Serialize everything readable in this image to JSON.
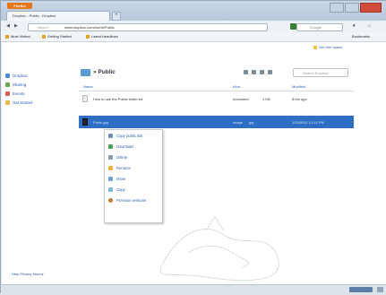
{
  "browser": {
    "app_button": "Firefox",
    "tab_title": "Dropbox - Public - Dropbox",
    "new_tab": "+",
    "url_prefix": "https://",
    "url_domain": "www.dropbox.com/home/Public",
    "search_placeholder": "Google",
    "bookmarks": [
      "Most Visited",
      "Getting Started",
      "Latest Headlines"
    ],
    "bookmarks_right": "Bookmarks"
  },
  "dropbox": {
    "upgrade": "Get free space",
    "sidebar": [
      "Dropbox",
      "Sharing",
      "Events",
      "Get Started"
    ],
    "breadcrumb": "Public",
    "search_placeholder": "Search Dropbox",
    "columns": {
      "name": "Name",
      "kind": "Kind",
      "modified": "Modified"
    },
    "files": [
      {
        "name": "How to use the Public folder.txt",
        "kind": "document",
        "size": "1 KB",
        "modified": "8 hrs ago"
      },
      {
        "name": "Photo.jpg",
        "kind": "image",
        "size": "jpg",
        "modified": "1/24/2011 12:14 PM"
      }
    ],
    "context_menu": [
      "Copy public link",
      "Download",
      "Delete",
      "Rename",
      "Move",
      "Copy",
      "Previous versions"
    ],
    "footer": "Help   Privacy   More ▸"
  }
}
